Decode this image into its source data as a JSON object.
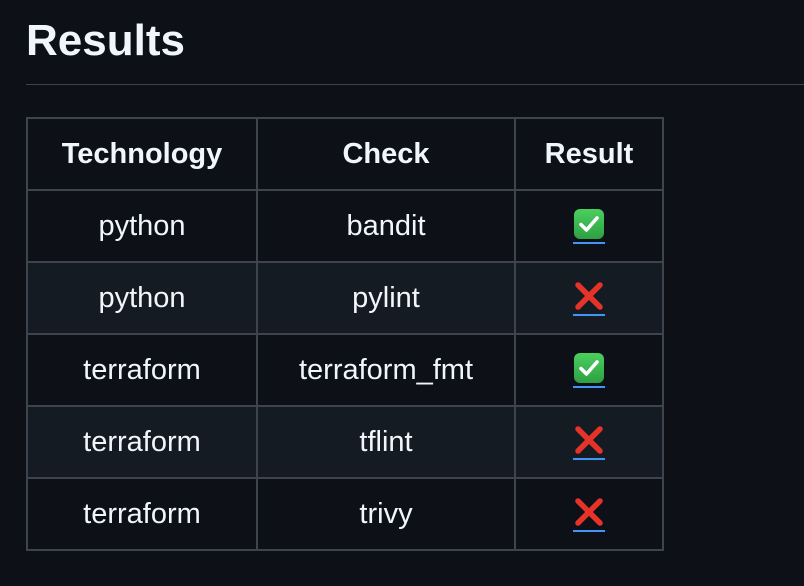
{
  "heading": "Results",
  "table": {
    "headers": {
      "technology": "Technology",
      "check": "Check",
      "result": "Result"
    },
    "rows": [
      {
        "technology": "python",
        "check": "bandit",
        "result": "pass",
        "result_icon": "check-mark-icon"
      },
      {
        "technology": "python",
        "check": "pylint",
        "result": "fail",
        "result_icon": "cross-mark-icon"
      },
      {
        "technology": "terraform",
        "check": "terraform_fmt",
        "result": "pass",
        "result_icon": "check-mark-icon"
      },
      {
        "technology": "terraform",
        "check": "tflint",
        "result": "fail",
        "result_icon": "cross-mark-icon"
      },
      {
        "technology": "terraform",
        "check": "trivy",
        "result": "fail",
        "result_icon": "cross-mark-icon"
      }
    ]
  },
  "colors": {
    "background": "#0d1117",
    "row_alt": "#151b23",
    "border": "#3d444d",
    "text": "#f0f6fc",
    "pass": "#3fb950",
    "fail": "#e5332a",
    "link_underline": "#4493f8"
  }
}
